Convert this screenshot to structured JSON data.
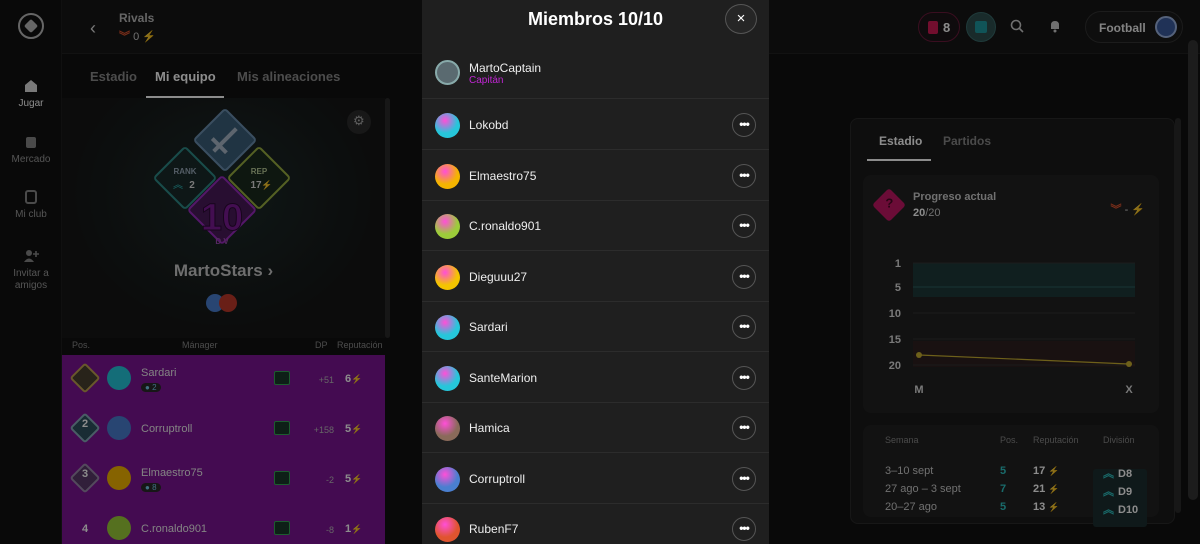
{
  "topbar": {
    "title": "Rivals",
    "sub_value": "0",
    "notif_count": "8",
    "sport_label": "Football"
  },
  "nav": [
    {
      "label": "Jugar",
      "icon": "home-icon",
      "active": true
    },
    {
      "label": "Mercado",
      "icon": "market-icon"
    },
    {
      "label": "Mi club",
      "icon": "club-icon"
    },
    {
      "label": "Invitar a amigos",
      "icon": "add-friend-icon"
    }
  ],
  "left": {
    "tabs": [
      "Estadio",
      "Mi equipo",
      "Mis alineaciones"
    ],
    "team_name": "MartoStars",
    "rank_label": "RANK",
    "rank_value": "2",
    "rep_label": "REP",
    "rep_value": "17",
    "division": "10",
    "division_sub": "D V",
    "head": {
      "pos": "Pos.",
      "manager": "Mánager",
      "dp": "DP",
      "rep": "Reputación"
    },
    "rows": [
      {
        "pos": "1",
        "name": "Sardari",
        "sub": "2",
        "dp": "+51",
        "rep": "6"
      },
      {
        "pos": "2",
        "name": "Corruptroll",
        "sub": "",
        "dp": "+158",
        "rep": "5"
      },
      {
        "pos": "3",
        "name": "Elmaestro75",
        "sub": "8",
        "dp": "-2",
        "rep": "5"
      },
      {
        "pos": "4",
        "name": "C.ronaldo901",
        "sub": "",
        "dp": "-8",
        "rep": "1"
      }
    ]
  },
  "right": {
    "tabs": [
      "Estadio",
      "Partidos"
    ],
    "progress_title": "Progreso actual",
    "progress_current": "20",
    "progress_total": "/20",
    "progress_delta": "-",
    "chart_y_ticks": [
      "1",
      "5",
      "10",
      "15",
      "20"
    ],
    "chart_x_ticks": [
      "M",
      "X"
    ],
    "weeks_head": {
      "week": "Semana",
      "pos": "Pos.",
      "rep": "Reputación",
      "div": "División"
    },
    "weeks": [
      {
        "week": "3–10 sept",
        "pos": "5",
        "rep": "17",
        "div": "D8"
      },
      {
        "week": "27 ago – 3 sept",
        "pos": "7",
        "rep": "21",
        "div": "D9"
      },
      {
        "week": "20–27 ago",
        "pos": "5",
        "rep": "13",
        "div": "D10"
      }
    ]
  },
  "modal": {
    "title": "Miembros 10/10",
    "close": "×",
    "captain_name": "MartoCaptain",
    "captain_role": "Capitán",
    "more_label": "•••",
    "members": [
      {
        "name": "Lokobd",
        "color": "#26c6da"
      },
      {
        "name": "Elmaestro75",
        "color": "#f4b400"
      },
      {
        "name": "C.ronaldo901",
        "color": "#9ccc3a"
      },
      {
        "name": "Dieguuu27",
        "color": "#f4c400"
      },
      {
        "name": "Sardari",
        "color": "#26c6da"
      },
      {
        "name": "SanteMarion",
        "color": "#26c6da"
      },
      {
        "name": "Hamica",
        "color": "#8a6a5a"
      },
      {
        "name": "Corruptroll",
        "color": "#4a7fd0"
      },
      {
        "name": "RubenF7",
        "color": "#e0542f"
      }
    ]
  },
  "colors": {
    "accent": "#c026d3",
    "row_bg": "#7d1594",
    "teal": "#2ec4c4",
    "bolt": "#e6c020"
  }
}
